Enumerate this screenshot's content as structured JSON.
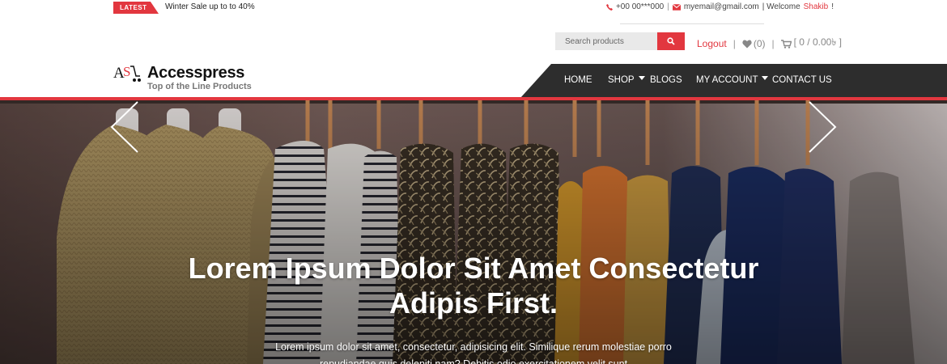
{
  "topbar": {
    "badge": "LATEST",
    "ticker": "Winter Sale up to to 40%",
    "phone": "+00 00***000",
    "email": "myemail@gmail.com",
    "welcome_prefix": "| Welcome",
    "username": "Shakib",
    "welcome_suffix": "!"
  },
  "search": {
    "placeholder": "Search products",
    "icon": "search-icon"
  },
  "account": {
    "logout_label": "Logout",
    "wishlist_count": "(0)",
    "cart_label": "[ 0 / 0.00৳ ]"
  },
  "brand": {
    "name": "Accesspress",
    "tagline": "Top of the Line Products"
  },
  "nav": {
    "items": [
      {
        "label": "HOME"
      },
      {
        "label": "SHOP"
      },
      {
        "label": "BLOGS"
      },
      {
        "label": "MY ACCOUNT"
      },
      {
        "label": "CONTACT US"
      }
    ]
  },
  "hero": {
    "title_line1": "Lorem Ipsum Dolor Sit Amet Consectetur",
    "title_line2": "Adipis First.",
    "text_line1": "Lorem ipsum dolor sit amet, consectetur, adipisicing elit. Similique rerum molestiae porro",
    "text_line2": "repudiandae quis deleniti nam? Debitis odio exercitationem velit sunt"
  },
  "colors": {
    "accent": "#e2373f",
    "nav_bg": "#2d2d2d"
  }
}
